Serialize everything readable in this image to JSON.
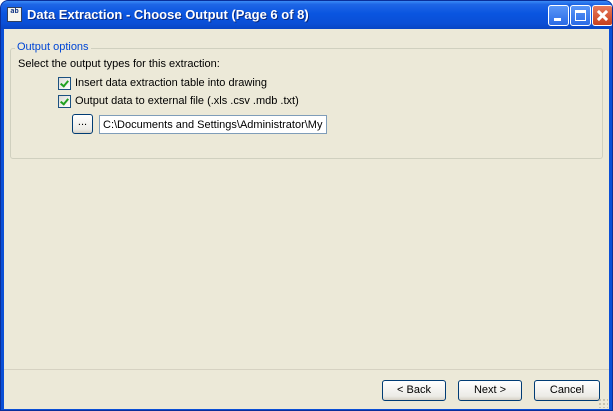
{
  "window": {
    "title": "Data Extraction - Choose Output (Page 6 of 8)",
    "app_icon_text": "ab"
  },
  "output_options": {
    "group_label": "Output options",
    "instruction": "Select the output types for this extraction:",
    "insert_table": {
      "label": "Insert data extraction table into drawing",
      "checked": true
    },
    "external_file": {
      "label": "Output data to external file (.xls .csv .mdb .txt)",
      "checked": true
    },
    "browse_label": "...",
    "file_path": "C:\\Documents and Settings\\Administrator\\My Documents"
  },
  "buttons": {
    "back": "< Back",
    "next": "Next >",
    "cancel": "Cancel"
  },
  "colors": {
    "titlebar": "#0a4fd6",
    "client_bg": "#ece9d8",
    "group_label": "#0046d5",
    "check_mark": "#21a121"
  }
}
